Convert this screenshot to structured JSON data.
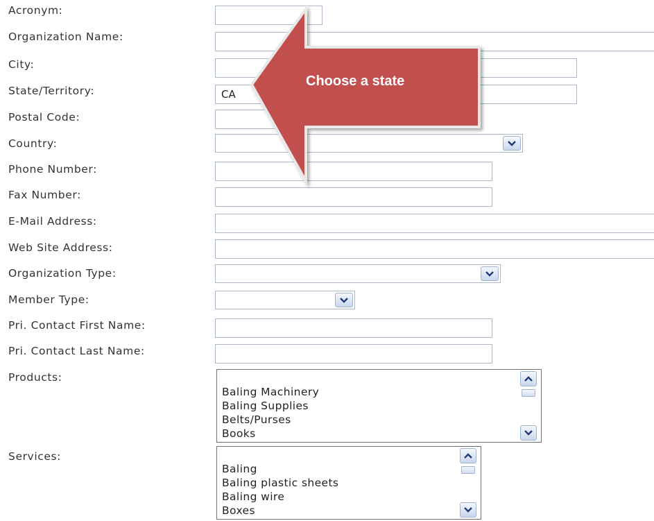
{
  "labels": {
    "acronym": "Acronym:",
    "organization_name": "Organization Name:",
    "city": "City:",
    "state": "State/Territory:",
    "postal_code": "Postal Code:",
    "country": "Country:",
    "phone": "Phone Number:",
    "fax": "Fax Number:",
    "email": "E-Mail Address:",
    "website": "Web Site Address:",
    "org_type": "Organization Type:",
    "member_type": "Member Type:",
    "first_name": "Pri. Contact First Name:",
    "last_name": "Pri. Contact Last Name:",
    "products": "Products:",
    "services": "Services:"
  },
  "values": {
    "acronym": "",
    "organization_name": "",
    "city": "",
    "state": "CA",
    "postal_code": "",
    "country": "",
    "phone": "",
    "fax": "",
    "email": "",
    "website": "",
    "org_type": "",
    "member_type": "",
    "first_name": "",
    "last_name": ""
  },
  "products": [
    "Baling Machinery",
    "Baling Supplies",
    "Belts/Purses",
    "Books"
  ],
  "services": [
    "Baling",
    "Baling plastic sheets",
    "Baling wire",
    "Boxes"
  ],
  "callout": {
    "text": "Choose a state",
    "color": "#c0504d"
  },
  "icons": {
    "dropdown": "chevron-down-icon",
    "scroll_up": "chevron-up-icon",
    "scroll_down": "chevron-down-icon"
  }
}
